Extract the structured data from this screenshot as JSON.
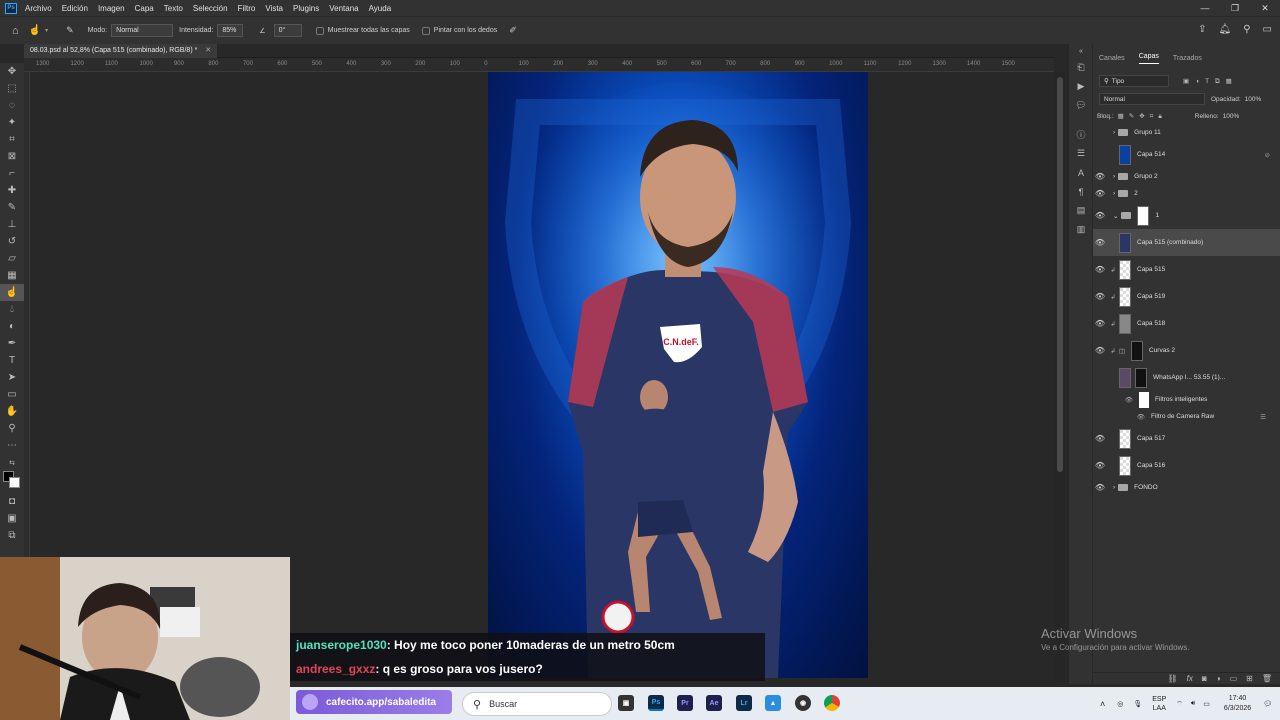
{
  "app": {
    "logo": "Ps"
  },
  "menubar": {
    "items": [
      "Archivo",
      "Edición",
      "Imagen",
      "Capa",
      "Texto",
      "Selección",
      "Filtro",
      "Vista",
      "Plugins",
      "Ventana",
      "Ayuda"
    ],
    "window_controls": [
      "—",
      "❐",
      "✕"
    ]
  },
  "options": {
    "mode_label": "Modo:",
    "mode_value": "Normal",
    "intensity_label": "Intensidad:",
    "intensity_value": "85%",
    "angle_value": "0°",
    "sample_all_label": "Muestrear todas las capas",
    "finger_label": "Pintar con los dedos"
  },
  "document": {
    "tab_title": "08.03.psd al 52,8% (Capa 515 (combinado), RGB/8) *"
  },
  "ruler": {
    "ticks": [
      "1300",
      "1200",
      "1100",
      "1000",
      "900",
      "800",
      "700",
      "600",
      "500",
      "400",
      "300",
      "200",
      "100",
      "0",
      "100",
      "200",
      "300",
      "400",
      "500",
      "600",
      "700",
      "800",
      "900",
      "1000",
      "1100",
      "1200",
      "1300",
      "1400",
      "1500"
    ]
  },
  "panel": {
    "tabs": [
      "Canales",
      "Capas",
      "Trazados"
    ],
    "active_tab": "Capas",
    "filter_label": "Tipo",
    "blend_mode": "Normal",
    "opacity_label": "Opacidad:",
    "opacity_value": "100%",
    "lock_label": "Bloq.:",
    "fill_label": "Relleno:",
    "fill_value": "100%",
    "layers": [
      {
        "name": "Grupo 11",
        "kind": "group",
        "visible": false,
        "selected": false
      },
      {
        "name": "Capa 514",
        "kind": "layer",
        "visible": false,
        "selected": false
      },
      {
        "name": "Grupo 2",
        "kind": "group",
        "visible": true,
        "selected": false
      },
      {
        "name": "2",
        "kind": "group",
        "visible": true,
        "selected": false
      },
      {
        "name": "1",
        "kind": "group",
        "visible": true,
        "selected": false
      },
      {
        "name": "Capa 515 (combinado)",
        "kind": "layer",
        "visible": true,
        "selected": true
      },
      {
        "name": "Capa 515",
        "kind": "layer",
        "visible": true,
        "selected": false
      },
      {
        "name": "Capa 519",
        "kind": "layer",
        "visible": true,
        "selected": false
      },
      {
        "name": "Capa 518",
        "kind": "layer",
        "visible": true,
        "selected": false
      },
      {
        "name": "Curvas 2",
        "kind": "adjustment",
        "visible": true,
        "selected": false
      },
      {
        "name": "WhatsApp I... 53.55 (1)...",
        "kind": "smart",
        "visible": false,
        "selected": false
      },
      {
        "name": "Filtros inteligentes",
        "kind": "sub",
        "visible": true,
        "selected": false
      },
      {
        "name": "Filtro de Camera Raw",
        "kind": "sub",
        "visible": true,
        "selected": false
      },
      {
        "name": "Capa 517",
        "kind": "layer",
        "visible": true,
        "selected": false
      },
      {
        "name": "Capa 516",
        "kind": "layer",
        "visible": true,
        "selected": false
      },
      {
        "name": "FONDO",
        "kind": "group",
        "visible": true,
        "selected": false
      }
    ]
  },
  "watermark": {
    "line1": "Activar Windows",
    "line2": "Ve a Configuración para activar Windows."
  },
  "chat": [
    {
      "user": "juanserope1030",
      "user_color": "#4fe3c1",
      "message": ": Hoy me toco poner 10maderas de un metro 50cm"
    },
    {
      "user": "andrees_gxxz",
      "user_color": "#e0455a",
      "message": ": q es groso para vos jusero?"
    }
  ],
  "promo": {
    "text": "cafecito.app/sabaledita"
  },
  "artwork": {
    "badge_text": "C.N.deF."
  },
  "taskbar": {
    "search_placeholder": "Buscar",
    "apps": [
      {
        "label": "Ps",
        "color": "#31a8ff",
        "bg": "#0e2a47"
      },
      {
        "label": "Pr",
        "color": "#9999ff",
        "bg": "#1f1f4d"
      },
      {
        "label": "Ae",
        "color": "#9999ff",
        "bg": "#1f1f4d"
      },
      {
        "label": "Lr",
        "color": "#31a8ff",
        "bg": "#0e2a47"
      }
    ],
    "tray": {
      "lang1": "ESP",
      "lang2": "LAA",
      "time": "17:40",
      "date": "6/3/2026"
    }
  }
}
